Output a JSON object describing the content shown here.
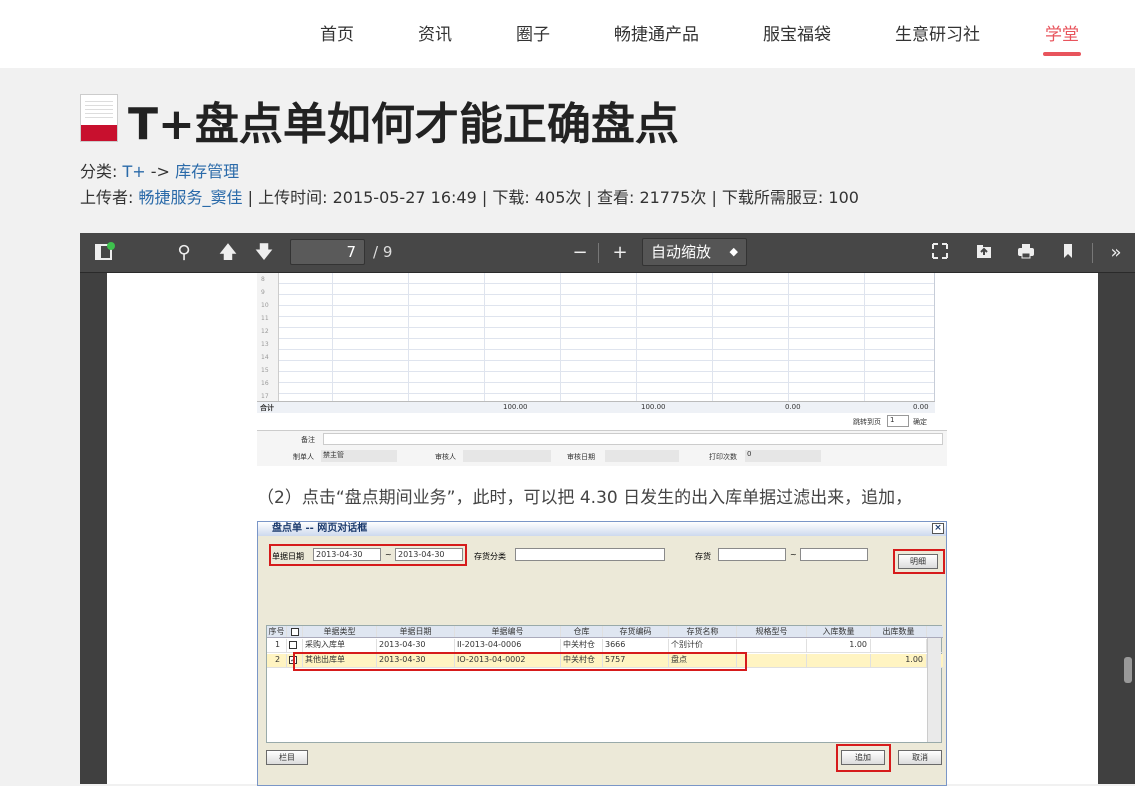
{
  "nav": {
    "items": [
      "首页",
      "资讯",
      "圈子",
      "畅捷通产品",
      "服宝福袋",
      "生意研习社",
      "学堂"
    ],
    "active_index": 6,
    "accent_color": "#e8545c"
  },
  "article": {
    "title": "T+盘点单如何才能正确盘点",
    "category_label": "分类:",
    "category_parent": "T+",
    "category_arrow": "->",
    "category_child": "库存管理",
    "uploader_label": "上传者:",
    "uploader": "畅捷服务_窦佳",
    "upload_time_label": "| 上传时间:",
    "upload_time": "2015-05-27 16:49",
    "downloads_label": "| 下载:",
    "downloads": "405次",
    "views_label": "| 查看:",
    "views": "21775次",
    "beans_label": "| 下载所需服豆:",
    "beans": "100"
  },
  "viewer": {
    "page_current": "7",
    "page_total": "/ 9",
    "zoom_label": "自动缩放",
    "icons": [
      "sidebar-toggle-icon",
      "search-icon",
      "arrow-up-icon",
      "arrow-down-icon",
      "zoom-out-icon",
      "zoom-in-icon",
      "fullscreen-icon",
      "open-file-icon",
      "print-icon",
      "bookmark-icon",
      "more-tools-icon"
    ],
    "toolbar_glyphs": {
      "search": "⚲",
      "up": "🡅",
      "down": "🡇",
      "minus": "−",
      "plus": "+",
      "more": "»"
    }
  },
  "sheet": {
    "row_numbers": [
      "8",
      "9",
      "10",
      "11",
      "12",
      "13",
      "14",
      "15",
      "16",
      "17"
    ],
    "total_label": "合计",
    "totals": [
      "100.00",
      "100.00",
      "0.00",
      "0.00"
    ],
    "jump_label": "跳转到页",
    "jump_value": "1",
    "confirm_label": "确定",
    "remark_label": "备注",
    "creator_label": "制单人",
    "creator": "禁主管",
    "auditor_label": "审核人",
    "audit_date_label": "审核日期",
    "print_count_label": "打印次数",
    "print_count": "0"
  },
  "caption": {
    "num": "（2）",
    "text": "点击“盘点期间业务”，此时，可以把 4.30 日发生的出入库单据过滤出来，追加，"
  },
  "dialog": {
    "title": "盘点单 -- 网页对话框",
    "date_label": "单据日期",
    "date_from": "2013-04-30",
    "date_to": "2013-04-30",
    "tilde": "~",
    "category_label": "存货分类",
    "stock_label": "存货",
    "detail_button": "明细",
    "columns": [
      "序号",
      "",
      "单据类型",
      "单据日期",
      "单据编号",
      "仓库",
      "存货编码",
      "存货名称",
      "规格型号",
      "入库数量",
      "出库数量"
    ],
    "rows": [
      {
        "no": "1",
        "checked": false,
        "type": "采购入库单",
        "date": "2013-04-30",
        "code": "II-2013-04-0006",
        "warehouse": "中关村仓",
        "item_code": "3666",
        "item_name": "个别计价",
        "spec": "",
        "in_qty": "1.00",
        "out_qty": ""
      },
      {
        "no": "2",
        "checked": true,
        "type": "其他出库单",
        "date": "2013-04-30",
        "code": "IO-2013-04-0002",
        "warehouse": "中关村仓",
        "item_code": "5757",
        "item_name": "盘点",
        "spec": "",
        "in_qty": "",
        "out_qty": "1.00"
      }
    ],
    "columns_button": "栏目",
    "add_button": "追加",
    "cancel_button": "取消",
    "check_mark": "✓",
    "close_mark": "×"
  }
}
